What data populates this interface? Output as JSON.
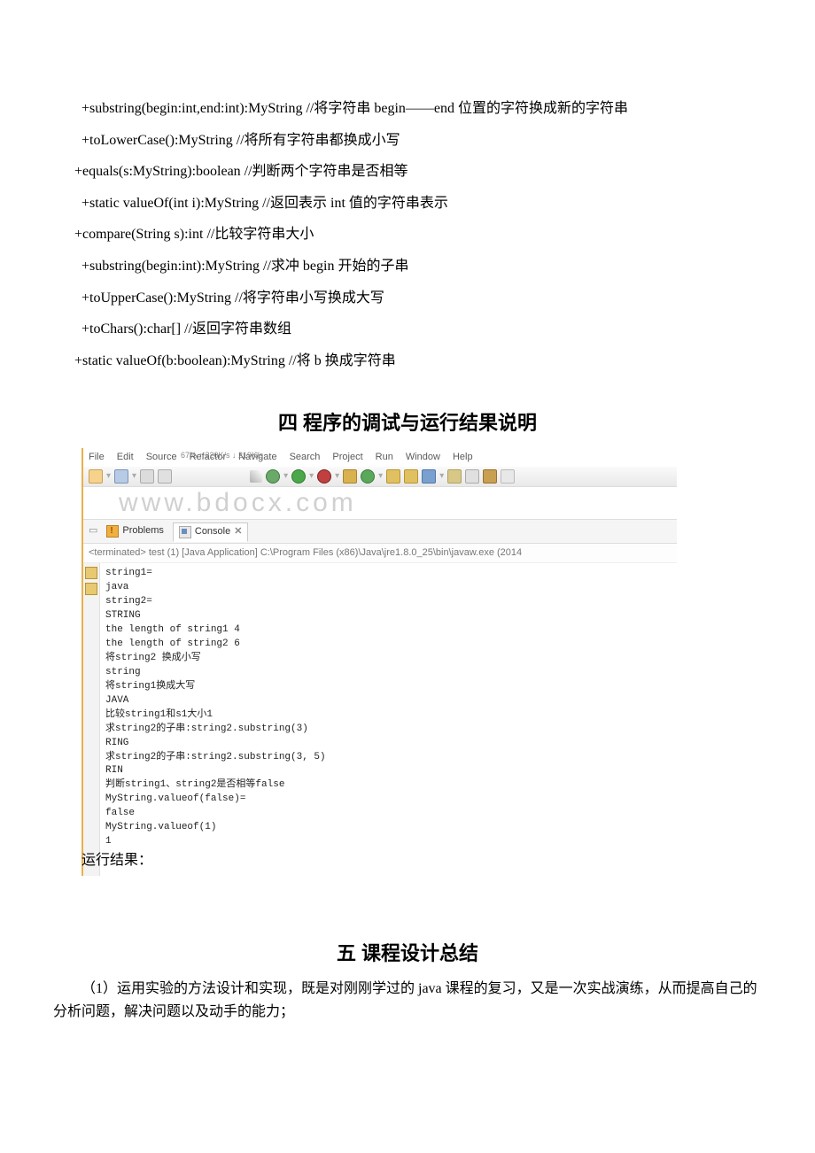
{
  "methods": [
    {
      "text": "+substring(begin:int,end:int):MyString //将字符串 begin——end 位置的字符换成新的字符串",
      "indent": true,
      "wrap": true
    },
    {
      "text": "+toLowerCase():MyString //将所有字符串都换成小写",
      "indent": true
    },
    {
      "text": "+equals(s:MyString):boolean //判断两个字符串是否相等",
      "indent": false
    },
    {
      "text": "+static valueOf(int i):MyString //返回表示 int 值的字符串表示",
      "indent": true
    },
    {
      "text": "+compare(String s):int //比较字符串大小",
      "indent": false
    },
    {
      "text": "+substring(begin:int):MyString //求冲 begin 开始的子串",
      "indent": true
    },
    {
      "text": "+toUpperCase():MyString //将字符串小写换成大写",
      "indent": true
    },
    {
      "text": "+toChars():char[] //返回字符串数组",
      "indent": true
    },
    {
      "text": "+static valueOf(b:boolean):MyString //将 b 换成字符串",
      "indent": false
    }
  ],
  "section4": {
    "heading": "四 程序的调试与运行结果说明",
    "run_label": "运行结果："
  },
  "ide": {
    "menu": [
      "File",
      "Edit",
      "Source",
      "Refactor",
      "Navigate",
      "Search",
      "Project",
      "Run",
      "Window",
      "Help"
    ],
    "net": "67%  ↑ 220K/s  ↓ 219K/s",
    "watermark": "www.bdocx.com",
    "tabs": {
      "problems": "Problems",
      "console": "Console"
    },
    "terminated": "<terminated> test (1) [Java Application] C:\\Program Files (x86)\\Java\\jre1.8.0_25\\bin\\javaw.exe (2014",
    "console_output": "string1=\njava\nstring2=\nSTRING\nthe length of string1 4\nthe length of string2 6\n将string2 换成小写\nstring\n将string1换成大写\nJAVA\n比较string1和s1大小1\n求string2的子串:string2.substring(3)\nRING\n求string2的子串:string2.substring(3, 5)\nRIN\n判断string1、string2是否相等false\nMyString.valueof(false)=\nfalse\nMyString.valueof(1)\n1"
  },
  "section5": {
    "heading": "五 课程设计总结",
    "para1": "（1）运用实验的方法设计和实现，既是对刚刚学过的 java 课程的复习，又是一次实战演练，从而提高自己的分析问题，解决问题以及动手的能力；"
  },
  "toolbar_colors": {
    "new": "#f7d28c",
    "save": "#b8cbe6",
    "bug": "#6aa96a",
    "run": "#4aa84a",
    "runred": "#c04040",
    "pkg": "#d9b24f",
    "open": "#e0c060",
    "search": "#7aa0d0",
    "wand": "#c8a050"
  }
}
